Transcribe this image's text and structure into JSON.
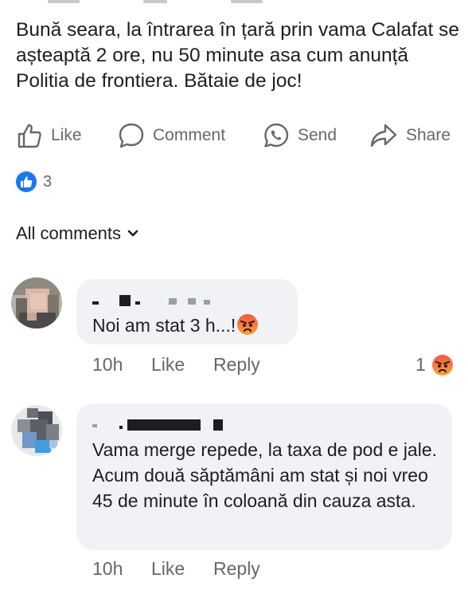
{
  "post": {
    "text": "Bună seara, la întrarea în țară prin vama Calafat se așteaptă 2 ore, nu 50 minute asa cum anunță Politia de frontiera. Bătaie de joc!"
  },
  "actions": {
    "like": "Like",
    "comment": "Comment",
    "send": "Send",
    "share": "Share"
  },
  "reactions": {
    "count": "3",
    "icon": "thumbs-up-icon",
    "color": "#1877f2"
  },
  "comments_header": {
    "label": "All comments"
  },
  "comments": [
    {
      "text": "Noi am stat 3 h...!",
      "time": "10h",
      "like_label": "Like",
      "reply_label": "Reply",
      "reaction_count": "1",
      "reaction_icon": "angry-emoji"
    },
    {
      "text": "Vama merge repede, la taxa de pod e jale. Acum două săptămâni am stat și noi vreo 45 de minute în coloană din cauza asta.",
      "time": "10h",
      "like_label": "Like",
      "reply_label": "Reply"
    }
  ]
}
